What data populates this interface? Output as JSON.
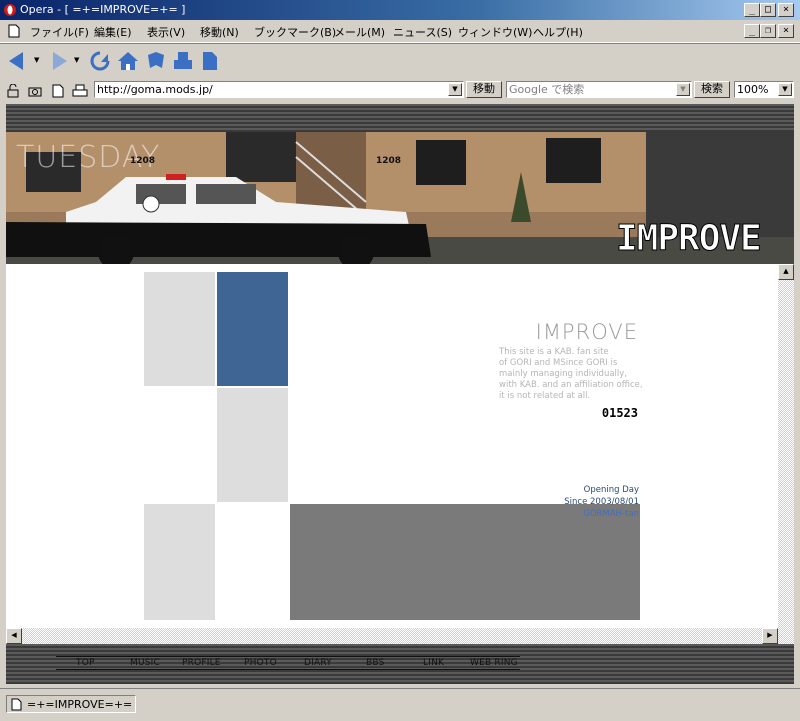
{
  "window": {
    "title": "Opera - [ =+=IMPROVE=+= ]"
  },
  "menu": [
    "ファイル(F)",
    "編集(E)",
    "表示(V)",
    "移動(N)",
    "ブックマーク(B)",
    "メール(M)",
    "ニュース(S)",
    "ウィンドウ(W)",
    "ヘルプ(H)"
  ],
  "address": {
    "url": "http://goma.mods.jp/",
    "go_label": "移動"
  },
  "search": {
    "placeholder": "Google で検索",
    "button_label": "検索"
  },
  "zoom": "100%",
  "banner": {
    "day": "TUESDAY",
    "logo": "IMPROVE",
    "sign_left": "1208",
    "sign_right": "1208"
  },
  "content": {
    "title": "IMPROVE",
    "description_lines": [
      "This site is a KAB. fan site",
      "of GORI and MSince GORI is",
      "mainly managing individually,",
      "with KAB. and an affiliation office,",
      "it is not related at all."
    ],
    "counter": "01523",
    "opening_day": "Opening Day",
    "since": "Since 2003/08/01",
    "author": "GORMAH-tan"
  },
  "nav": [
    "TOP",
    "MUSIC",
    "PROFILE",
    "PHOTO",
    "DIARY",
    "BBS",
    "LINK",
    "WEB RING"
  ],
  "status": {
    "text": "=+=IMPROVE=+="
  },
  "colors": {
    "blue_tile": "#3f6594",
    "gray_block": "#7a7a7a",
    "light_tile": "#dddddd"
  }
}
